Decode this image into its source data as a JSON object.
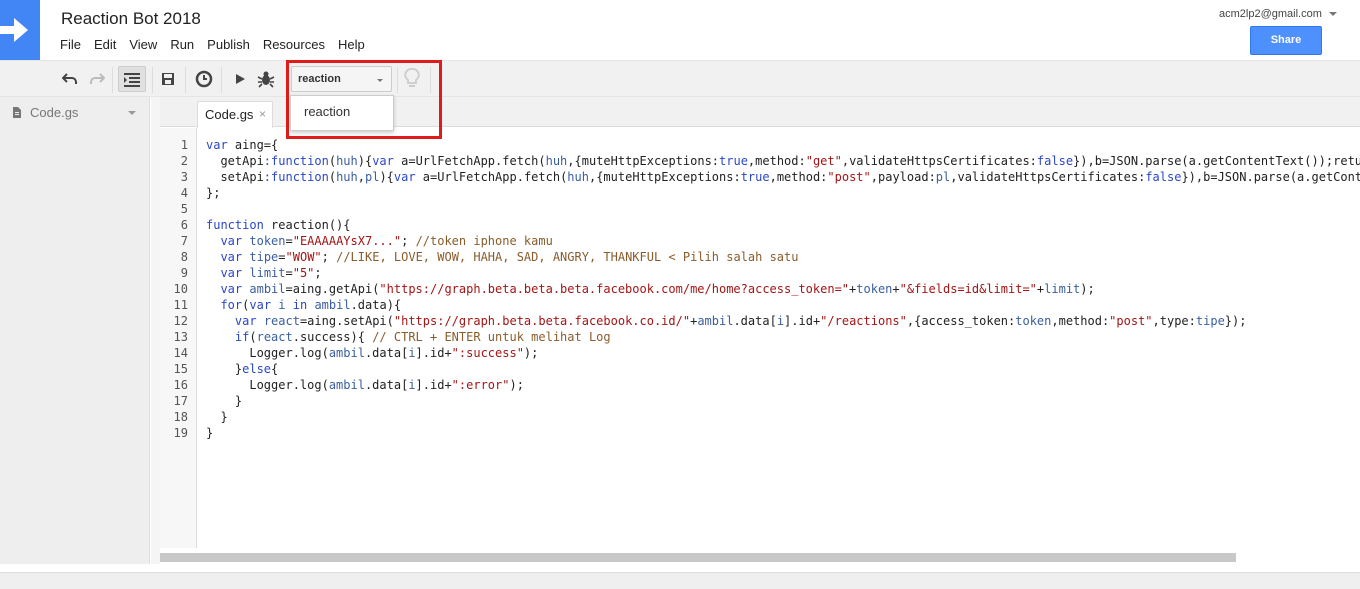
{
  "app": {
    "title": "Reaction Bot 2018",
    "brand_color": "#4285f4"
  },
  "menu": [
    "File",
    "Edit",
    "View",
    "Run",
    "Publish",
    "Resources",
    "Help"
  ],
  "account": {
    "email": "acm2lp2@gmail.com"
  },
  "share": {
    "label": "Share",
    "color": "#4d90fe"
  },
  "toolbar": {
    "icons": [
      "undo-icon",
      "redo-icon",
      "indent-icon",
      "save-icon",
      "triggers-icon",
      "run-icon",
      "debug-icon",
      "lightbulb-icon"
    ],
    "function_select": {
      "value": "reaction"
    }
  },
  "dropdown": {
    "options": [
      "reaction"
    ]
  },
  "highlight_color": "#e01b1b",
  "sidebar": {
    "file": "Code.gs"
  },
  "tabs": [
    {
      "label": "Code.gs",
      "close": "×"
    }
  ],
  "code": {
    "line_numbers": [
      "1",
      "2",
      "3",
      "4",
      "5",
      "6",
      "7",
      "8",
      "9",
      "10",
      "11",
      "12",
      "13",
      "14",
      "15",
      "16",
      "17",
      "18",
      "19"
    ],
    "lines": [
      [
        {
          "t": "kw",
          "v": "var"
        },
        {
          "t": "",
          "v": " aing={"
        }
      ],
      [
        {
          "t": "",
          "v": "  getApi"
        },
        {
          "t": "kw",
          "v": ":function"
        },
        {
          "t": "",
          "v": "("
        },
        {
          "t": "vr",
          "v": "huh"
        },
        {
          "t": "",
          "v": "){"
        },
        {
          "t": "kw",
          "v": "var"
        },
        {
          "t": "",
          "v": " a=UrlFetchApp.fetch("
        },
        {
          "t": "vr",
          "v": "huh"
        },
        {
          "t": "",
          "v": ",{muteHttpExceptions:"
        },
        {
          "t": "kw",
          "v": "true"
        },
        {
          "t": "",
          "v": ",method:"
        },
        {
          "t": "str",
          "v": "\"get\""
        },
        {
          "t": "",
          "v": ",validateHttpsCertificates:"
        },
        {
          "t": "kw",
          "v": "false"
        },
        {
          "t": "",
          "v": "}),b=JSON.parse(a.getContentText());retu"
        }
      ],
      [
        {
          "t": "",
          "v": "  setApi"
        },
        {
          "t": "kw",
          "v": ":function"
        },
        {
          "t": "",
          "v": "("
        },
        {
          "t": "vr",
          "v": "huh"
        },
        {
          "t": "",
          "v": ","
        },
        {
          "t": "vr",
          "v": "pl"
        },
        {
          "t": "",
          "v": "){"
        },
        {
          "t": "kw",
          "v": "var"
        },
        {
          "t": "",
          "v": " a=UrlFetchApp.fetch("
        },
        {
          "t": "vr",
          "v": "huh"
        },
        {
          "t": "",
          "v": ",{muteHttpExceptions:"
        },
        {
          "t": "kw",
          "v": "true"
        },
        {
          "t": "",
          "v": ",method:"
        },
        {
          "t": "str",
          "v": "\"post\""
        },
        {
          "t": "",
          "v": ",payload:"
        },
        {
          "t": "vr",
          "v": "pl"
        },
        {
          "t": "",
          "v": ",validateHttpsCertificates:"
        },
        {
          "t": "kw",
          "v": "false"
        },
        {
          "t": "",
          "v": "}),b=JSON.parse(a.getConte"
        }
      ],
      [
        {
          "t": "",
          "v": "};"
        }
      ],
      [
        {
          "t": "",
          "v": ""
        }
      ],
      [
        {
          "t": "kw",
          "v": "function"
        },
        {
          "t": "",
          "v": " reaction(){"
        }
      ],
      [
        {
          "t": "",
          "v": "  "
        },
        {
          "t": "kw",
          "v": "var"
        },
        {
          "t": "",
          "v": " "
        },
        {
          "t": "vr",
          "v": "token"
        },
        {
          "t": "",
          "v": "="
        },
        {
          "t": "str",
          "v": "\"EAAAAAYsX7...\""
        },
        {
          "t": "",
          "v": "; "
        },
        {
          "t": "cm",
          "v": "//token iphone kamu"
        }
      ],
      [
        {
          "t": "",
          "v": "  "
        },
        {
          "t": "kw",
          "v": "var"
        },
        {
          "t": "",
          "v": " "
        },
        {
          "t": "vr",
          "v": "tipe"
        },
        {
          "t": "",
          "v": "="
        },
        {
          "t": "str",
          "v": "\"WOW\""
        },
        {
          "t": "",
          "v": "; "
        },
        {
          "t": "cm",
          "v": "//LIKE, LOVE, WOW, HAHA, SAD, ANGRY, THANKFUL < Pilih salah satu"
        }
      ],
      [
        {
          "t": "",
          "v": "  "
        },
        {
          "t": "kw",
          "v": "var"
        },
        {
          "t": "",
          "v": " "
        },
        {
          "t": "vr",
          "v": "limit"
        },
        {
          "t": "",
          "v": "="
        },
        {
          "t": "str",
          "v": "\"5\""
        },
        {
          "t": "",
          "v": ";"
        }
      ],
      [
        {
          "t": "",
          "v": "  "
        },
        {
          "t": "kw",
          "v": "var"
        },
        {
          "t": "",
          "v": " "
        },
        {
          "t": "vr",
          "v": "ambil"
        },
        {
          "t": "",
          "v": "=aing.getApi("
        },
        {
          "t": "str",
          "v": "\"https://graph.beta.beta.beta.facebook.com/me/home?access_token=\""
        },
        {
          "t": "",
          "v": "+"
        },
        {
          "t": "vr",
          "v": "token"
        },
        {
          "t": "",
          "v": "+"
        },
        {
          "t": "str",
          "v": "\"&fields=id&limit=\""
        },
        {
          "t": "",
          "v": "+"
        },
        {
          "t": "vr",
          "v": "limit"
        },
        {
          "t": "",
          "v": ");"
        }
      ],
      [
        {
          "t": "",
          "v": "  "
        },
        {
          "t": "kw",
          "v": "for"
        },
        {
          "t": "",
          "v": "("
        },
        {
          "t": "kw",
          "v": "var"
        },
        {
          "t": "",
          "v": " "
        },
        {
          "t": "vr",
          "v": "i"
        },
        {
          "t": "",
          "v": " "
        },
        {
          "t": "kw",
          "v": "in"
        },
        {
          "t": "",
          "v": " "
        },
        {
          "t": "vr",
          "v": "ambil"
        },
        {
          "t": "",
          "v": ".data){"
        }
      ],
      [
        {
          "t": "",
          "v": "    "
        },
        {
          "t": "kw",
          "v": "var"
        },
        {
          "t": "",
          "v": " "
        },
        {
          "t": "vr",
          "v": "react"
        },
        {
          "t": "",
          "v": "=aing.setApi("
        },
        {
          "t": "str",
          "v": "\"https://graph.beta.beta.facebook.co.id/\""
        },
        {
          "t": "",
          "v": "+"
        },
        {
          "t": "vr",
          "v": "ambil"
        },
        {
          "t": "",
          "v": ".data["
        },
        {
          "t": "vr",
          "v": "i"
        },
        {
          "t": "",
          "v": "].id+"
        },
        {
          "t": "str",
          "v": "\"/reactions\""
        },
        {
          "t": "",
          "v": ",{access_token:"
        },
        {
          "t": "vr",
          "v": "token"
        },
        {
          "t": "",
          "v": ",method:"
        },
        {
          "t": "str",
          "v": "\"post\""
        },
        {
          "t": "",
          "v": ",type:"
        },
        {
          "t": "vr",
          "v": "tipe"
        },
        {
          "t": "",
          "v": "});"
        }
      ],
      [
        {
          "t": "",
          "v": "    "
        },
        {
          "t": "kw",
          "v": "if"
        },
        {
          "t": "",
          "v": "("
        },
        {
          "t": "vr",
          "v": "react"
        },
        {
          "t": "",
          "v": ".success){ "
        },
        {
          "t": "cm",
          "v": "// CTRL + ENTER untuk melihat Log"
        }
      ],
      [
        {
          "t": "",
          "v": "      Logger.log("
        },
        {
          "t": "vr",
          "v": "ambil"
        },
        {
          "t": "",
          "v": ".data["
        },
        {
          "t": "vr",
          "v": "i"
        },
        {
          "t": "",
          "v": "].id+"
        },
        {
          "t": "str",
          "v": "\":success\""
        },
        {
          "t": "",
          "v": ");"
        }
      ],
      [
        {
          "t": "",
          "v": "    }"
        },
        {
          "t": "kw",
          "v": "else"
        },
        {
          "t": "",
          "v": "{"
        }
      ],
      [
        {
          "t": "",
          "v": "      Logger.log("
        },
        {
          "t": "vr",
          "v": "ambil"
        },
        {
          "t": "",
          "v": ".data["
        },
        {
          "t": "vr",
          "v": "i"
        },
        {
          "t": "",
          "v": "].id+"
        },
        {
          "t": "str",
          "v": "\":error\""
        },
        {
          "t": "",
          "v": ");"
        }
      ],
      [
        {
          "t": "",
          "v": "    }"
        }
      ],
      [
        {
          "t": "",
          "v": "  }"
        }
      ],
      [
        {
          "t": "",
          "v": "}"
        }
      ]
    ]
  }
}
